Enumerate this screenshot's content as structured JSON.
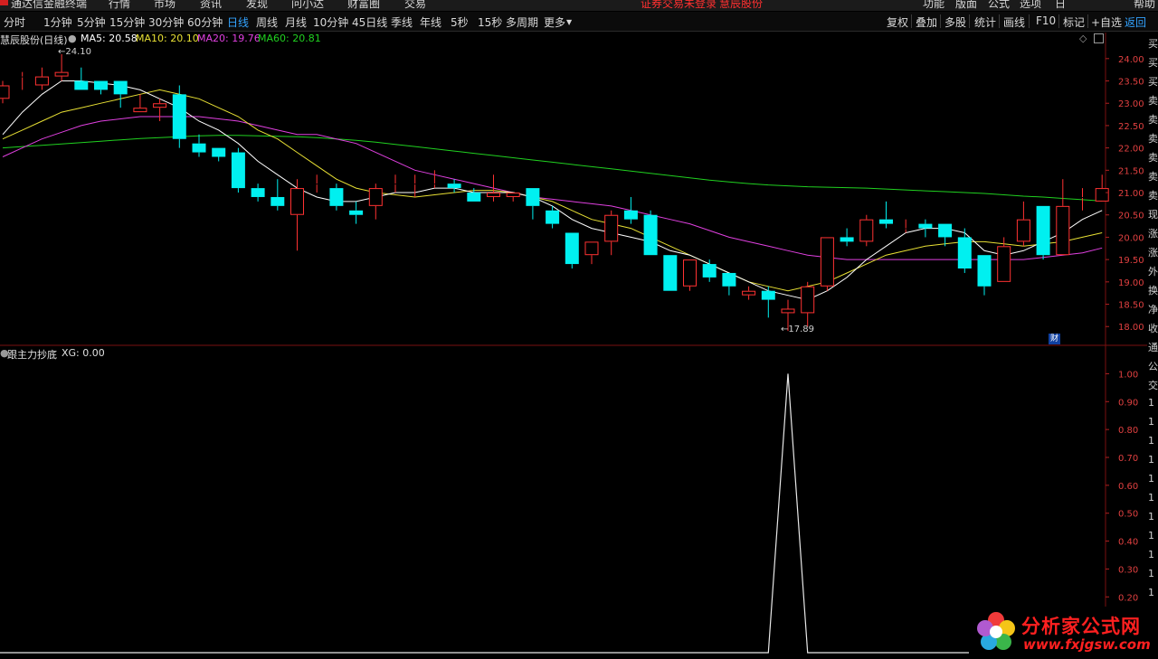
{
  "topmenu": {
    "app_title": "通达信金融终端",
    "items": [
      "行情",
      "市场",
      "资讯",
      "发现",
      "问小达",
      "财富圈",
      "交易"
    ],
    "broker_notice": "证券交易未登录",
    "stock_name": "慧辰股份",
    "right_items": [
      "功能",
      "版面",
      "公式",
      "选项",
      "日",
      "帮助"
    ]
  },
  "toolbar": {
    "periods": [
      "分时",
      "1分钟",
      "5分钟",
      "15分钟",
      "30分钟",
      "60分钟",
      "日线",
      "周线",
      "月线",
      "10分钟",
      "45日线",
      "季线",
      "年线",
      "5秒",
      "15秒",
      "多周期",
      "更多"
    ],
    "active_period": "日线",
    "right_buttons": [
      "复权",
      "叠加",
      "多股",
      "统计",
      "画线",
      "F10",
      "标记",
      "+自选",
      "返回"
    ],
    "return_label": "返回"
  },
  "main_chart": {
    "stock_title": "慧辰股份(日线)",
    "ma5_label": "MA5: 20.58",
    "ma10_label": "MA10: 20.10",
    "ma20_label": "MA20: 19.76",
    "ma60_label": "MA60: 20.81",
    "high_label": "24.10",
    "low_label": "17.89",
    "finance_badge": "财",
    "colors": {
      "up": "#ff3232",
      "down": "#00f0f0",
      "ma5": "#ffffff",
      "ma10": "#e8e034",
      "ma20": "#e040e0",
      "ma60": "#20d020"
    }
  },
  "indicator": {
    "name": "跟主力抄底",
    "value_label": "XG: 0.00"
  },
  "right_column_chars": [
    "买",
    "买",
    "买",
    "卖",
    "卖",
    "卖",
    "卖",
    "卖",
    "卖",
    "现",
    "涨",
    "涨",
    "外",
    "换",
    "净",
    "收",
    "通",
    "公",
    "交",
    "1",
    "1",
    "1",
    "1",
    "1",
    "1",
    "1",
    "1",
    "1",
    "1",
    "1"
  ],
  "watermark": {
    "title": "分析家公式网",
    "url": "www.fxjgsw.com"
  },
  "chart_data": [
    {
      "type": "candlestick",
      "name": "慧辰股份 日线",
      "ylim": [
        17.6,
        24.3
      ],
      "yticks": [
        "24.00",
        "23.50",
        "23.00",
        "22.50",
        "22.00",
        "21.50",
        "21.00",
        "20.50",
        "20.00",
        "19.50",
        "19.00",
        "18.50",
        "18.00"
      ],
      "candles": [
        {
          "o": 23.1,
          "c": 23.4,
          "h": 23.5,
          "l": 23.0
        },
        {
          "o": 23.6,
          "c": 23.6,
          "h": 23.7,
          "l": 23.3
        },
        {
          "o": 23.4,
          "c": 23.6,
          "h": 23.8,
          "l": 23.3
        },
        {
          "o": 23.6,
          "c": 23.7,
          "h": 24.1,
          "l": 23.5
        },
        {
          "o": 23.5,
          "c": 23.3,
          "h": 23.8,
          "l": 23.3
        },
        {
          "o": 23.5,
          "c": 23.3,
          "h": 23.5,
          "l": 23.2
        },
        {
          "o": 23.5,
          "c": 23.2,
          "h": 23.5,
          "l": 22.9
        },
        {
          "o": 22.8,
          "c": 22.9,
          "h": 23.2,
          "l": 22.8
        },
        {
          "o": 22.9,
          "c": 23.0,
          "h": 23.1,
          "l": 22.6
        },
        {
          "o": 23.2,
          "c": 22.2,
          "h": 23.4,
          "l": 22.0
        },
        {
          "o": 22.1,
          "c": 21.9,
          "h": 22.3,
          "l": 21.8
        },
        {
          "o": 22.0,
          "c": 21.8,
          "h": 22.0,
          "l": 21.7
        },
        {
          "o": 21.9,
          "c": 21.1,
          "h": 22.0,
          "l": 21.0
        },
        {
          "o": 21.1,
          "c": 20.9,
          "h": 21.2,
          "l": 20.8
        },
        {
          "o": 20.9,
          "c": 20.7,
          "h": 21.3,
          "l": 20.6
        },
        {
          "o": 20.5,
          "c": 21.1,
          "h": 21.3,
          "l": 19.7
        },
        {
          "o": 21.2,
          "c": 21.2,
          "h": 21.4,
          "l": 21.0
        },
        {
          "o": 21.1,
          "c": 20.7,
          "h": 21.2,
          "l": 20.6
        },
        {
          "o": 20.6,
          "c": 20.5,
          "h": 20.8,
          "l": 20.3
        },
        {
          "o": 20.7,
          "c": 21.1,
          "h": 21.2,
          "l": 20.4
        },
        {
          "o": 21.2,
          "c": 21.2,
          "h": 21.4,
          "l": 21.0
        },
        {
          "o": 21.2,
          "c": 21.2,
          "h": 21.4,
          "l": 20.9
        },
        {
          "o": 21.2,
          "c": 21.2,
          "h": 21.5,
          "l": 21.1
        },
        {
          "o": 21.2,
          "c": 21.1,
          "h": 21.3,
          "l": 21.0
        },
        {
          "o": 21.0,
          "c": 20.8,
          "h": 21.1,
          "l": 20.8
        },
        {
          "o": 20.9,
          "c": 21.0,
          "h": 21.4,
          "l": 20.8
        },
        {
          "o": 20.9,
          "c": 21.0,
          "h": 21.0,
          "l": 20.8
        },
        {
          "o": 21.1,
          "c": 20.7,
          "h": 21.1,
          "l": 20.4
        },
        {
          "o": 20.6,
          "c": 20.3,
          "h": 20.7,
          "l": 20.2
        },
        {
          "o": 20.1,
          "c": 19.4,
          "h": 20.1,
          "l": 19.3
        },
        {
          "o": 19.6,
          "c": 19.9,
          "h": 19.9,
          "l": 19.4
        },
        {
          "o": 19.9,
          "c": 20.5,
          "h": 20.6,
          "l": 19.6
        },
        {
          "o": 20.6,
          "c": 20.4,
          "h": 20.9,
          "l": 20.3
        },
        {
          "o": 20.5,
          "c": 19.6,
          "h": 20.6,
          "l": 19.6
        },
        {
          "o": 19.6,
          "c": 18.8,
          "h": 19.6,
          "l": 18.8
        },
        {
          "o": 18.9,
          "c": 19.5,
          "h": 19.5,
          "l": 18.8
        },
        {
          "o": 19.4,
          "c": 19.1,
          "h": 19.5,
          "l": 19.0
        },
        {
          "o": 19.2,
          "c": 18.9,
          "h": 19.2,
          "l": 18.7
        },
        {
          "o": 18.7,
          "c": 18.8,
          "h": 18.9,
          "l": 18.6
        },
        {
          "o": 18.8,
          "c": 18.6,
          "h": 18.9,
          "l": 18.2
        },
        {
          "o": 18.3,
          "c": 18.4,
          "h": 18.6,
          "l": 17.9
        },
        {
          "o": 18.3,
          "c": 18.9,
          "h": 19.0,
          "l": 18.0
        },
        {
          "o": 18.9,
          "c": 20.0,
          "h": 20.0,
          "l": 18.8
        },
        {
          "o": 20.0,
          "c": 19.9,
          "h": 20.2,
          "l": 19.8
        },
        {
          "o": 19.9,
          "c": 20.4,
          "h": 20.5,
          "l": 19.8
        },
        {
          "o": 20.4,
          "c": 20.3,
          "h": 20.8,
          "l": 20.2
        },
        {
          "o": 20.2,
          "c": 20.2,
          "h": 20.4,
          "l": 20.1
        },
        {
          "o": 20.3,
          "c": 20.2,
          "h": 20.4,
          "l": 20.0
        },
        {
          "o": 20.3,
          "c": 20.0,
          "h": 20.3,
          "l": 19.8
        },
        {
          "o": 20.0,
          "c": 19.3,
          "h": 20.2,
          "l": 19.2
        },
        {
          "o": 19.6,
          "c": 18.9,
          "h": 19.6,
          "l": 18.7
        },
        {
          "o": 19.0,
          "c": 19.8,
          "h": 20.0,
          "l": 19.0
        },
        {
          "o": 19.9,
          "c": 20.4,
          "h": 20.8,
          "l": 19.8
        },
        {
          "o": 20.7,
          "c": 19.6,
          "h": 20.7,
          "l": 19.5
        },
        {
          "o": 19.6,
          "c": 20.7,
          "h": 21.3,
          "l": 19.6
        },
        {
          "o": 20.9,
          "c": 20.9,
          "h": 21.1,
          "l": 20.6
        },
        {
          "o": 20.8,
          "c": 21.1,
          "h": 21.4,
          "l": 20.8
        }
      ],
      "ma5": [
        22.3,
        22.8,
        23.2,
        23.5,
        23.5,
        23.45,
        23.4,
        23.3,
        23.1,
        22.9,
        22.6,
        22.4,
        22.1,
        21.7,
        21.4,
        21.1,
        20.9,
        20.8,
        20.8,
        20.9,
        21.0,
        21.0,
        21.1,
        21.1,
        21.0,
        21.0,
        21.0,
        20.9,
        20.7,
        20.4,
        20.2,
        20.1,
        20.0,
        19.9,
        19.7,
        19.6,
        19.4,
        19.2,
        19.0,
        18.8,
        18.7,
        18.6,
        18.8,
        19.1,
        19.5,
        19.8,
        20.1,
        20.2,
        20.2,
        20.1,
        19.7,
        19.6,
        19.7,
        19.9,
        20.1,
        20.4,
        20.6
      ],
      "ma10": [
        22.2,
        22.4,
        22.6,
        22.8,
        22.9,
        23.0,
        23.1,
        23.2,
        23.3,
        23.2,
        23.1,
        22.9,
        22.7,
        22.4,
        22.2,
        21.9,
        21.6,
        21.3,
        21.1,
        21.0,
        20.95,
        20.9,
        20.95,
        21.0,
        21.05,
        21.05,
        21.0,
        20.9,
        20.8,
        20.6,
        20.4,
        20.3,
        20.2,
        20.0,
        19.8,
        19.6,
        19.4,
        19.2,
        19.0,
        18.9,
        18.8,
        18.9,
        19.0,
        19.2,
        19.4,
        19.6,
        19.7,
        19.8,
        19.85,
        19.9,
        19.9,
        19.85,
        19.8,
        19.85,
        19.9,
        20.0,
        20.1
      ],
      "ma20": [
        21.8,
        22.0,
        22.2,
        22.35,
        22.5,
        22.6,
        22.65,
        22.7,
        22.7,
        22.7,
        22.7,
        22.65,
        22.6,
        22.5,
        22.4,
        22.3,
        22.3,
        22.2,
        22.1,
        21.9,
        21.7,
        21.5,
        21.4,
        21.3,
        21.2,
        21.1,
        21.0,
        20.9,
        20.85,
        20.8,
        20.75,
        20.7,
        20.6,
        20.5,
        20.4,
        20.3,
        20.15,
        20.0,
        19.9,
        19.8,
        19.7,
        19.6,
        19.55,
        19.5,
        19.5,
        19.5,
        19.5,
        19.5,
        19.5,
        19.5,
        19.5,
        19.5,
        19.5,
        19.55,
        19.6,
        19.65,
        19.76
      ],
      "ma60": [
        22.0,
        22.03,
        22.06,
        22.09,
        22.12,
        22.15,
        22.18,
        22.21,
        22.23,
        22.25,
        22.27,
        22.28,
        22.28,
        22.27,
        22.26,
        22.25,
        22.23,
        22.2,
        22.17,
        22.13,
        22.08,
        22.03,
        21.98,
        21.93,
        21.88,
        21.83,
        21.78,
        21.73,
        21.68,
        21.63,
        21.58,
        21.53,
        21.48,
        21.43,
        21.38,
        21.33,
        21.28,
        21.24,
        21.2,
        21.17,
        21.15,
        21.13,
        21.12,
        21.11,
        21.1,
        21.08,
        21.06,
        21.04,
        21.02,
        21.0,
        20.98,
        20.95,
        20.92,
        20.9,
        20.87,
        20.84,
        20.81
      ]
    },
    {
      "type": "line",
      "name": "XG",
      "ylim": [
        0,
        1.05
      ],
      "yticks": [
        "1.00",
        "0.90",
        "0.80",
        "0.70",
        "0.60",
        "0.50",
        "0.40",
        "0.30",
        "0.20"
      ],
      "values": [
        0,
        0,
        0,
        0,
        0,
        0,
        0,
        0,
        0,
        0,
        0,
        0,
        0,
        0,
        0,
        0,
        0,
        0,
        0,
        0,
        0,
        0,
        0,
        0,
        0,
        0,
        0,
        0,
        0,
        0,
        0,
        0,
        0,
        0,
        0,
        0,
        0,
        0,
        0,
        0,
        1,
        0,
        0,
        0,
        0,
        0,
        0,
        0,
        0,
        0,
        0,
        0,
        0,
        0,
        0,
        0,
        0
      ]
    }
  ]
}
